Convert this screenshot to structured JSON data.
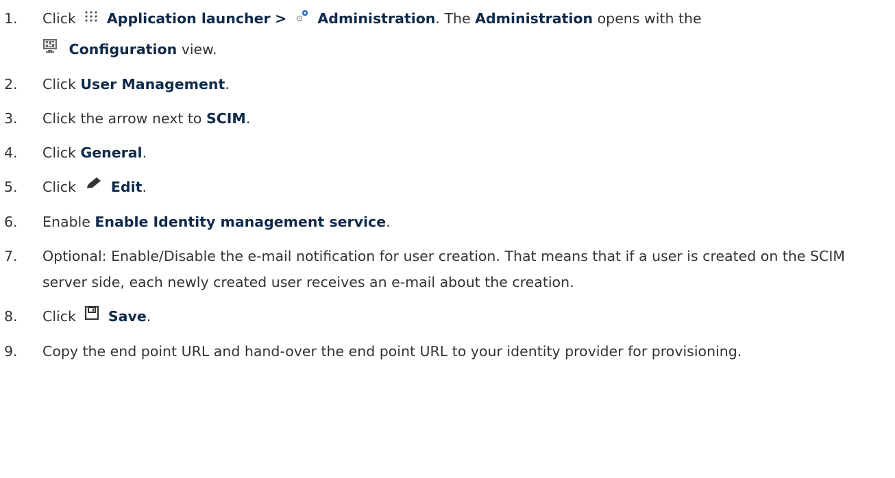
{
  "steps": [
    {
      "num": "1.",
      "click": "Click",
      "launcher": "Application launcher",
      "sep": ">",
      "admin": "Administration",
      "mid": ". The",
      "admin2": "Administration",
      "opens": "opens with the",
      "config": "Configuration",
      "view": "view."
    },
    {
      "num": "2.",
      "pre": "Click",
      "bold": "User Management",
      "post": "."
    },
    {
      "num": "3.",
      "pre": "Click the arrow next to",
      "bold": "SCIM",
      "post": "."
    },
    {
      "num": "4.",
      "pre": "Click",
      "bold": "General",
      "post": "."
    },
    {
      "num": "5.",
      "pre": "Click",
      "bold": "Edit",
      "post": "."
    },
    {
      "num": "6.",
      "pre": "Enable",
      "bold": "Enable Identity management service",
      "post": "."
    },
    {
      "num": "7.",
      "text": "Optional: Enable/Disable the e-mail notification for user creation. That means that if a user is created on the SCIM server side, each newly created user receives an e-mail about the creation."
    },
    {
      "num": "8.",
      "pre": "Click",
      "bold": "Save",
      "post": "."
    },
    {
      "num": "9.",
      "text": "Copy the end point URL and hand-over the end point URL to your identity provider for provisioning."
    }
  ],
  "icons": {
    "launcher": "grid-dots-icon",
    "admin": "gears-icon",
    "config": "configuration-icon",
    "edit": "pencil-icon",
    "save": "floppy-disk-icon"
  },
  "colors": {
    "text": "#333333",
    "bold": "#0f2a4a",
    "gear_blue": "#2f6fd0"
  }
}
